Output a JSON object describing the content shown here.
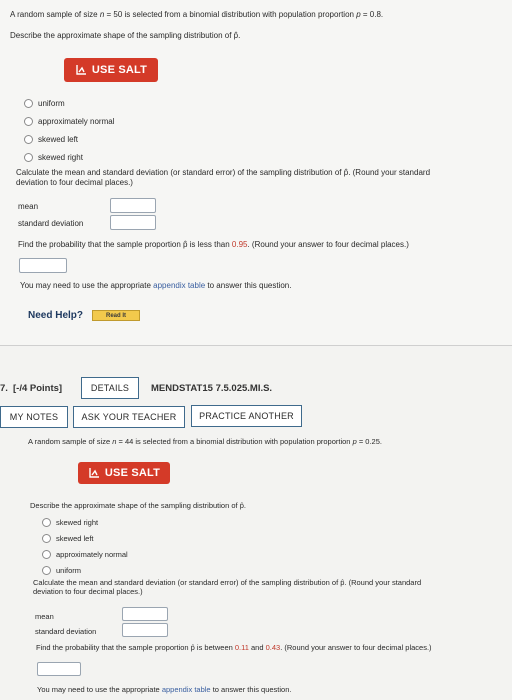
{
  "q6": {
    "intro_before": "A random sample of size ",
    "intro_n": "n",
    "intro_mid": " = 50 is selected from a binomial distribution with population proportion ",
    "intro_p": "p",
    "intro_value": " = 0.8.",
    "shape_prompt": "Describe the approximate shape of the sampling distribution of p̂.",
    "salt_label": "USE SALT",
    "options": [
      "uniform",
      "approximately normal",
      "skewed left",
      "skewed right"
    ],
    "calc_prompt_1": "Calculate the mean and standard deviation (or standard error) of the sampling distribution of p̂. (Round your standard",
    "calc_prompt_2": "deviation to four decimal places.)",
    "mean_label": "mean",
    "sd_label": "standard deviation",
    "prob_before": "Find the probability that the sample proportion p̂ is less than ",
    "prob_value": "0.95",
    "prob_after": ". (Round your answer to four decimal places.)",
    "appendix_before": "You may need to use the appropriate ",
    "appendix_link": "appendix table",
    "appendix_after": " to answer this question.",
    "need_help": "Need Help?",
    "read_it": "Read It"
  },
  "q7": {
    "number": "7.",
    "points": "[-/4 Points]",
    "details_label": "DETAILS",
    "code": "MENDSTAT15 7.5.025.MI.S.",
    "my_notes": "MY NOTES",
    "ask_teacher": "ASK YOUR TEACHER",
    "practice_another": "PRACTICE ANOTHER",
    "intro_before": "A random sample of size ",
    "intro_n": "n",
    "intro_mid": " = 44 is selected from a binomial distribution with population proportion ",
    "intro_p": "p",
    "intro_value": " = 0.25.",
    "salt_label": "USE SALT",
    "shape_prompt": "Describe the approximate shape of the sampling distribution of p̂.",
    "options": [
      "skewed right",
      "skewed left",
      "approximately normal",
      "uniform"
    ],
    "calc_prompt_1": "Calculate the mean and standard deviation (or standard error) of the sampling distribution of p̂. (Round your standard",
    "calc_prompt_2": "deviation to four decimal places.)",
    "mean_label": "mean",
    "sd_label": "standard deviation",
    "prob_before": "Find the probability that the sample proportion p̂ is between ",
    "prob_low": "0.11",
    "prob_and": " and ",
    "prob_high": "0.43",
    "prob_after": ". (Round your answer to four decimal places.)",
    "appendix_before": "You may need to use the appropriate ",
    "appendix_link": "appendix table",
    "appendix_after": " to answer this question."
  },
  "colors": {
    "salt": "#d43a28",
    "accent_red": "#c0392b",
    "link": "#3a5fa0",
    "button_border": "#3f6a8c"
  },
  "icons": {
    "salt": "salt-icon"
  }
}
